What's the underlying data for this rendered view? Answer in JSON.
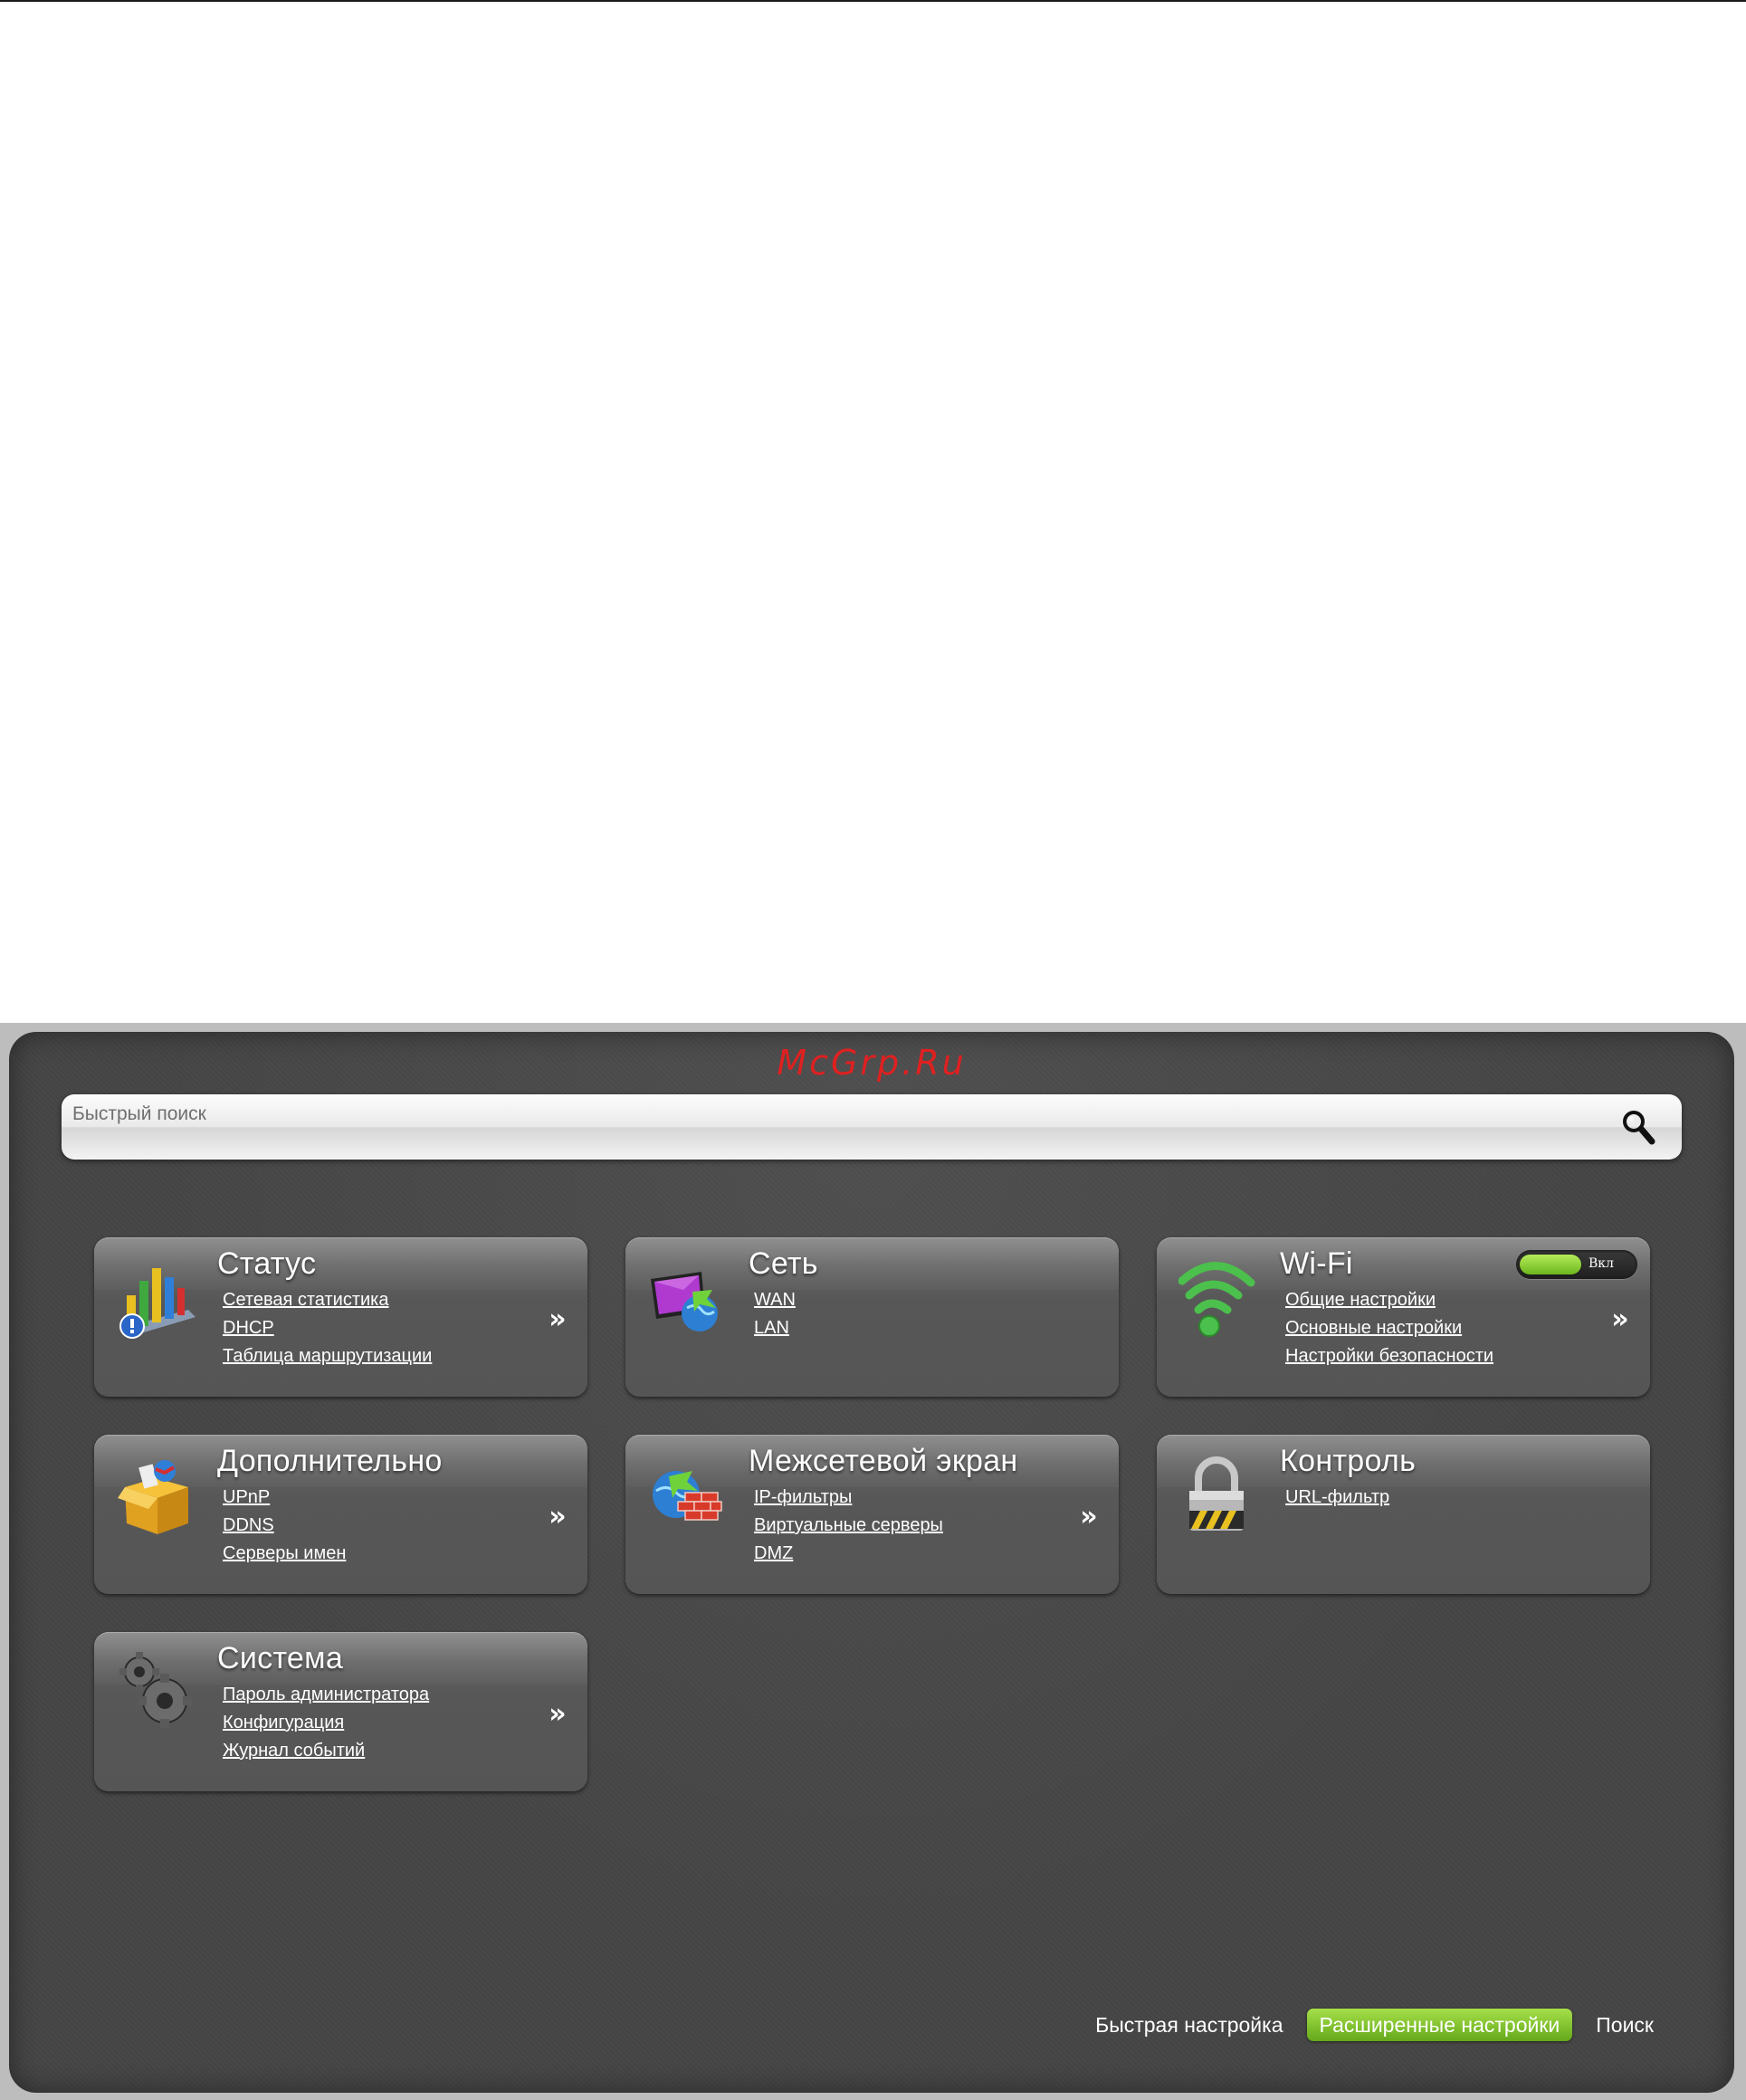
{
  "watermark": "McGrp.Ru",
  "search": {
    "placeholder": "Быстрый поиск"
  },
  "cards": {
    "status": {
      "title": "Статус",
      "icon": "status-chart-icon",
      "links": [
        "Сетевая статистика",
        "DHCP",
        "Таблица маршрутизации"
      ],
      "arrow": "»"
    },
    "network": {
      "title": "Сеть",
      "icon": "network-globe-icon",
      "links": [
        "WAN",
        "LAN"
      ]
    },
    "wifi": {
      "title": "Wi-Fi",
      "icon": "wifi-signal-icon",
      "toggle_label": "Вкл",
      "toggle_on": true,
      "links": [
        "Общие настройки",
        "Основные настройки",
        "Настройки безопасности"
      ],
      "arrow": "»"
    },
    "advanced": {
      "title": "Дополнительно",
      "icon": "package-box-icon",
      "links": [
        "UPnP",
        "DDNS",
        "Серверы имен"
      ],
      "arrow": "»"
    },
    "firewall": {
      "title": "Межсетевой экран",
      "icon": "firewall-globe-icon",
      "links": [
        "IP-фильтры",
        "Виртуальные серверы",
        "DMZ"
      ],
      "arrow": "»"
    },
    "control": {
      "title": "Контроль",
      "icon": "padlock-icon",
      "links": [
        "URL-фильтр"
      ]
    },
    "system": {
      "title": "Система",
      "icon": "gears-icon",
      "links": [
        "Пароль администратора",
        "Конфигурация",
        "Журнал событий"
      ],
      "arrow": "»"
    }
  },
  "bottom_nav": {
    "quick_setup": "Быстрая настройка",
    "advanced_settings": "Расширенные настройки",
    "search": "Поиск"
  },
  "colors": {
    "accent_green": "#8cc63f",
    "panel_bg": "#454545",
    "watermark_red": "#e02020"
  }
}
